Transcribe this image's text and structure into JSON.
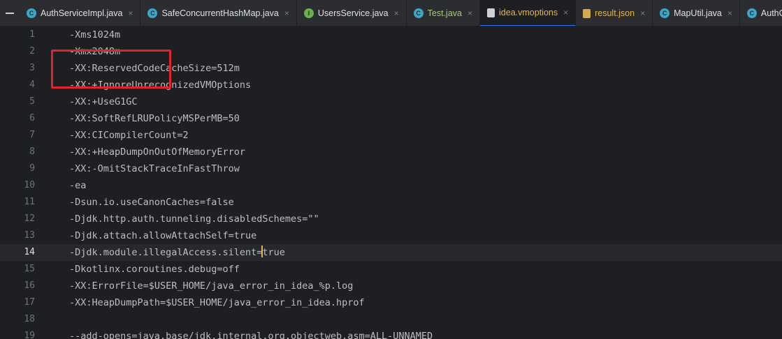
{
  "tabs": [
    {
      "label": "AuthServiceImpl.java",
      "icon": "java-class-icon",
      "icon_class": "java",
      "label_class": ""
    },
    {
      "label": "SafeConcurrentHashMap.java",
      "icon": "java-class-icon",
      "icon_class": "java",
      "label_class": ""
    },
    {
      "label": "UsersService.java",
      "icon": "java-interface-icon",
      "icon_class": "iface",
      "label_class": ""
    },
    {
      "label": "Test.java",
      "icon": "java-runnable-icon",
      "icon_class": "runnable",
      "label_class": "green"
    },
    {
      "label": "idea.vmoptions",
      "icon": "text-file-icon",
      "icon_class": "file",
      "label_class": "",
      "active": true
    },
    {
      "label": "result.json",
      "icon": "json-file-icon",
      "icon_class": "json",
      "label_class": "amber"
    },
    {
      "label": "MapUtil.java",
      "icon": "java-class-icon",
      "icon_class": "java",
      "label_class": ""
    },
    {
      "label": "AuthController.java",
      "icon": "java-class-icon",
      "icon_class": "java",
      "label_class": ""
    }
  ],
  "tab_close_glyph": "×",
  "editor": {
    "current_line": 14,
    "lines": [
      {
        "num": "1",
        "text": "-Xms1024m"
      },
      {
        "num": "2",
        "text": "-Xmx2048m"
      },
      {
        "num": "3",
        "text": "-XX:ReservedCodeCacheSize=512m"
      },
      {
        "num": "4",
        "text": "-XX:+IgnoreUnrecognizedVMOptions"
      },
      {
        "num": "5",
        "text": "-XX:+UseG1GC"
      },
      {
        "num": "6",
        "text": "-XX:SoftRefLRUPolicyMSPerMB=50"
      },
      {
        "num": "7",
        "text": "-XX:CICompilerCount=2"
      },
      {
        "num": "8",
        "text": "-XX:+HeapDumpOnOutOfMemoryError"
      },
      {
        "num": "9",
        "text": "-XX:-OmitStackTraceInFastThrow"
      },
      {
        "num": "10",
        "text": "-ea"
      },
      {
        "num": "11",
        "text": "-Dsun.io.useCanonCaches=false"
      },
      {
        "num": "12",
        "text": "-Djdk.http.auth.tunneling.disabledSchemes=\"\""
      },
      {
        "num": "13",
        "text": "-Djdk.attach.allowAttachSelf=true"
      },
      {
        "num": "14",
        "text": "-Djdk.module.illegalAccess.silent=true",
        "caret_after": "-Djdk.module.illegalAccess.silent="
      },
      {
        "num": "15",
        "text": "-Dkotlinx.coroutines.debug=off"
      },
      {
        "num": "16",
        "text": "-XX:ErrorFile=$USER_HOME/java_error_in_idea_%p.log"
      },
      {
        "num": "17",
        "text": "-XX:HeapDumpPath=$USER_HOME/java_error_in_idea.hprof"
      },
      {
        "num": "18",
        "text": ""
      },
      {
        "num": "19",
        "text": "--add-opens=java.base/jdk.internal.org.objectweb.asm=ALL-UNNAMED"
      }
    ]
  },
  "colors": {
    "background": "#1e1f22",
    "tabbar": "#2b2d30",
    "highlight_box": "#e0242c",
    "caret": "#e3b64d",
    "active_tab_underline": "#3574f0"
  }
}
